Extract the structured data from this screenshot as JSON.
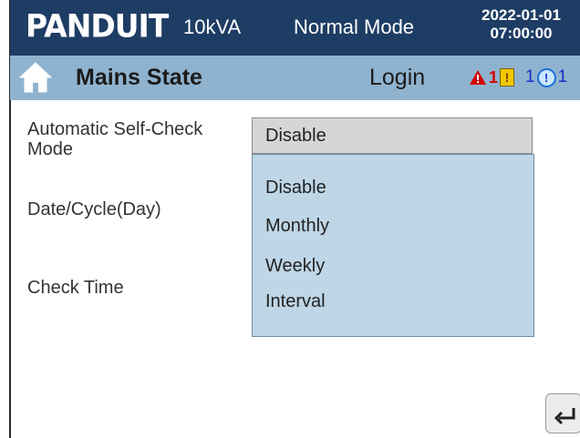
{
  "header": {
    "brand": "PANDUIT",
    "capacity": "10kVA",
    "mode": "Normal Mode",
    "date": "2022-01-01",
    "time": "07:00:00"
  },
  "subheader": {
    "title": "Mains State",
    "login_label": "Login",
    "alarm_count": "1",
    "warning_count": "1",
    "info_count": "1"
  },
  "form": {
    "self_check_label": "Automatic Self-Check Mode",
    "self_check_value": "Disable",
    "self_check_options": [
      "Disable",
      "Monthly",
      "Weekly",
      "Interval"
    ],
    "date_cycle_label": "Date/Cycle(Day)",
    "check_time_label": "Check Time"
  },
  "icons": {
    "home": "home-icon",
    "alarm": "alarm-triangle-icon",
    "warning": "warning-icon",
    "info": "info-icon",
    "back": "back-arrow-icon"
  },
  "colors": {
    "header_bg": "#1e3d64",
    "subheader_bg": "#8fb3cf",
    "dropdown_bg": "#bed6e6",
    "alarm_red": "#d40000"
  }
}
